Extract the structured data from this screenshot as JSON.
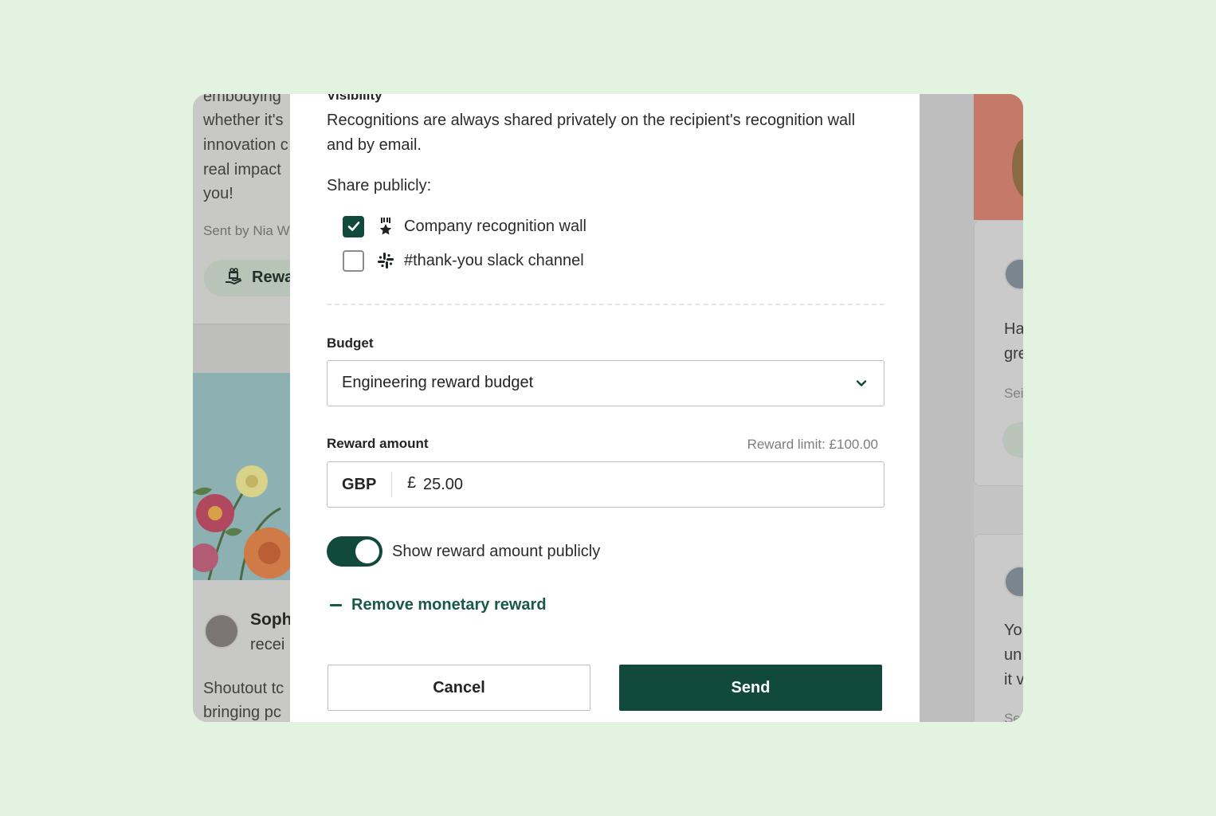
{
  "background": {
    "left_post": {
      "text_lines": [
        "embodying",
        "whether it's",
        "innovation c",
        "real impact",
        "you!"
      ],
      "sent_by": "Sent by Nia W",
      "reward_pill_label": "Rewa",
      "next_post_name": "Soph",
      "next_post_subtitle": "recei",
      "next_post_text_lines": [
        "Shoutout tc",
        "bringing pc"
      ]
    },
    "right_post": {
      "text_lines_a": [
        "Ha",
        "gre"
      ],
      "faint_a": "Sei",
      "text_lines_b": [
        "Yo",
        "un",
        "it v"
      ],
      "faint_b": "Se"
    }
  },
  "modal": {
    "visibility": {
      "heading": "Visibility",
      "description": "Recognitions are always shared privately on the recipient's recognition wall and by email.",
      "share_label": "Share publicly:",
      "options": [
        {
          "label": "Company recognition wall",
          "icon": "award-ribbon-icon",
          "checked": true
        },
        {
          "label": "#thank-you slack channel",
          "icon": "slack-icon",
          "checked": false
        }
      ]
    },
    "budget": {
      "label": "Budget",
      "selected": "Engineering reward budget"
    },
    "reward": {
      "label": "Reward amount",
      "limit_text": "Reward limit: £100.00",
      "currency_code": "GBP",
      "currency_symbol": "£",
      "amount": "25.00"
    },
    "show_publicly": {
      "label": "Show reward amount publicly",
      "enabled": true
    },
    "remove_link": "Remove monetary reward",
    "buttons": {
      "cancel": "Cancel",
      "send": "Send"
    }
  },
  "colors": {
    "page_bg": "#e2f3df",
    "accent": "#114a3c",
    "link": "#1a5848"
  }
}
